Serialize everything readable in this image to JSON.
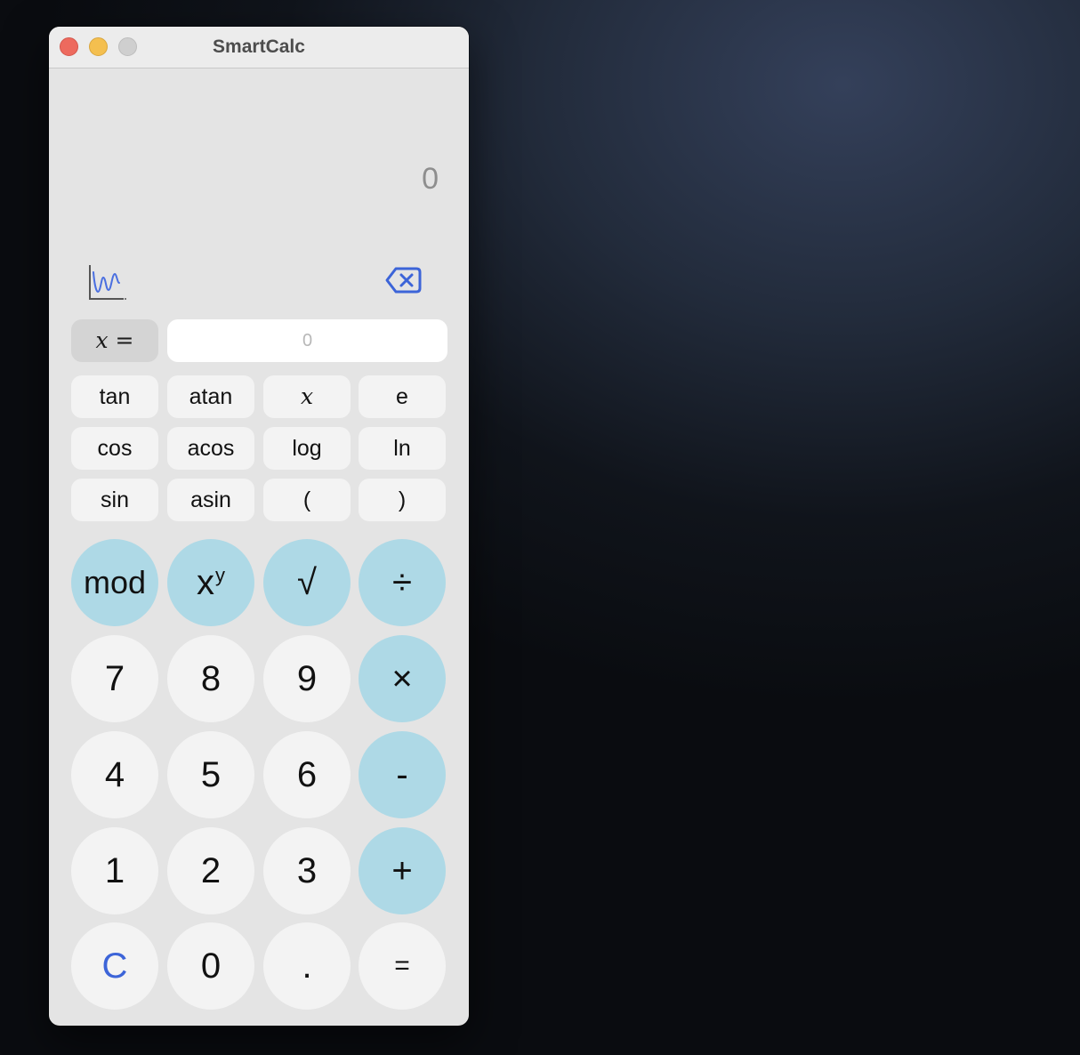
{
  "window": {
    "title": "SmartCalc"
  },
  "display": {
    "value": "0"
  },
  "x_field": {
    "label": "x =",
    "placeholder": "0",
    "value": ""
  },
  "icons": {
    "graph": "graph-icon",
    "backspace": "backspace-icon",
    "accent_color": "#3c64d8"
  },
  "function_rows": [
    [
      "tan",
      "atan",
      "x",
      "e"
    ],
    [
      "cos",
      "acos",
      "log",
      "ln"
    ],
    [
      "sin",
      "asin",
      "(",
      ")"
    ]
  ],
  "keypad": {
    "mod": "mod",
    "power_base": "x",
    "power_exp": "y",
    "sqrt": "√",
    "divide": "÷",
    "seven": "7",
    "eight": "8",
    "nine": "9",
    "multiply": "×",
    "four": "4",
    "five": "5",
    "six": "6",
    "minus": "-",
    "one": "1",
    "two": "2",
    "three": "3",
    "plus": "+",
    "clear": "C",
    "zero": "0",
    "dot": ".",
    "equals": "="
  },
  "colors": {
    "operator_button": "#aed9e6",
    "digit_button": "#f3f3f3",
    "window_bg": "#e4e4e4"
  }
}
